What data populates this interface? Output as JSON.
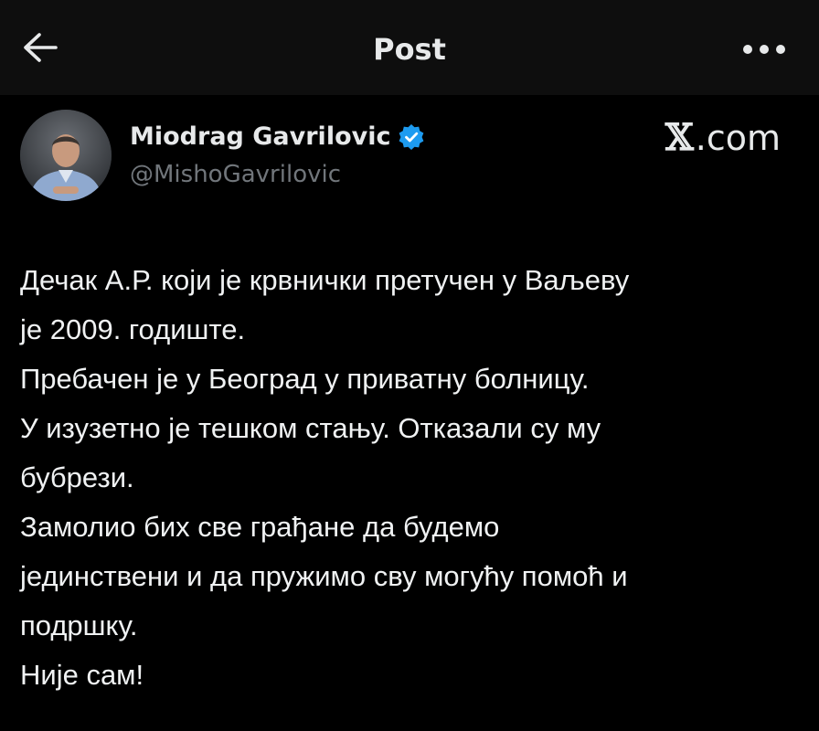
{
  "header": {
    "title": "Post",
    "back_icon": "arrow-left-icon",
    "more_icon": "more-horizontal-icon"
  },
  "author": {
    "name": "Miodrag Gavrilovic",
    "handle": "@MishoGavrilovic",
    "verified": true,
    "verified_color": "#1d9bf0"
  },
  "source": {
    "logo": "𝕏",
    "suffix": ".com"
  },
  "post": {
    "lines": [
      "Дечак А.Р. који је крвнички претучен у Ваљеву",
      "је 2009. годиште.",
      "Пребачен је у Београд у приватну болницу.",
      "У изузетно је тешком стању. Отказали су му",
      "бубрези.",
      "Замолио бих све грађане да будемо",
      "јединствени и да пружимо сву могућу помоћ и",
      "подршку.",
      "Није сам!"
    ]
  },
  "colors": {
    "background": "#000000",
    "topbar": "#0e0e0e",
    "text": "#e7e9ea",
    "muted": "#71767b"
  }
}
